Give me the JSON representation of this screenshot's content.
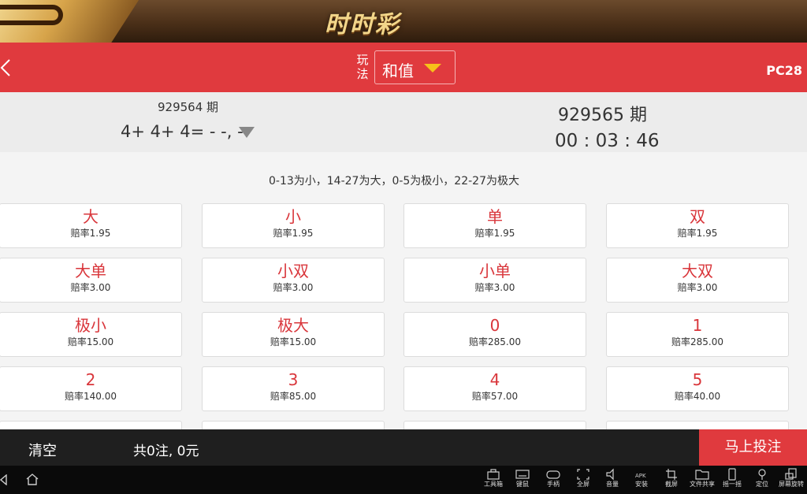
{
  "banner": {
    "title": "时时彩"
  },
  "header": {
    "play_label": "玩法",
    "play_value": "和值",
    "game_code": "PC28"
  },
  "issue": {
    "prev_number": "929564 期",
    "prev_result": "4+ 4+ 4= - -, -",
    "current_number": "929565 期",
    "countdown": "00 : 03 : 46"
  },
  "rule_text": "0-13为小，14-27为大，0-5为极小，22-27为极大",
  "bets": [
    {
      "label": "大",
      "odds": "赔率1.95"
    },
    {
      "label": "小",
      "odds": "赔率1.95"
    },
    {
      "label": "单",
      "odds": "赔率1.95"
    },
    {
      "label": "双",
      "odds": "赔率1.95"
    },
    {
      "label": "大单",
      "odds": "赔率3.00"
    },
    {
      "label": "小双",
      "odds": "赔率3.00"
    },
    {
      "label": "小单",
      "odds": "赔率3.00"
    },
    {
      "label": "大双",
      "odds": "赔率3.00"
    },
    {
      "label": "极小",
      "odds": "赔率15.00"
    },
    {
      "label": "极大",
      "odds": "赔率15.00"
    },
    {
      "label": "0",
      "odds": "赔率285.00"
    },
    {
      "label": "1",
      "odds": "赔率285.00"
    },
    {
      "label": "2",
      "odds": "赔率140.00"
    },
    {
      "label": "3",
      "odds": "赔率85.00"
    },
    {
      "label": "4",
      "odds": "赔率57.00"
    },
    {
      "label": "5",
      "odds": "赔率40.00"
    }
  ],
  "footer": {
    "clear": "清空",
    "total": "共0注, 0元",
    "submit": "马上投注"
  },
  "system_bar": {
    "tools": [
      {
        "icon": "toolbox-icon",
        "label": "工具箱"
      },
      {
        "icon": "keyboard-icon",
        "label": "键鼠"
      },
      {
        "icon": "gamepad-icon",
        "label": "手柄"
      },
      {
        "icon": "fullscreen-icon",
        "label": "全屏"
      },
      {
        "icon": "volume-icon",
        "label": "音量"
      },
      {
        "icon": "apk-icon",
        "label": "安装"
      },
      {
        "icon": "crop-icon",
        "label": "截屏"
      },
      {
        "icon": "folder-icon",
        "label": "文件共享"
      },
      {
        "icon": "shake-icon",
        "label": "摇一摇"
      },
      {
        "icon": "location-icon",
        "label": "定位"
      },
      {
        "icon": "rotate-icon",
        "label": "屏幕旋转"
      }
    ]
  },
  "colors": {
    "brand_red": "#e03a3e",
    "bet_red": "#d9363b",
    "caret_yellow": "#f7c21a"
  }
}
